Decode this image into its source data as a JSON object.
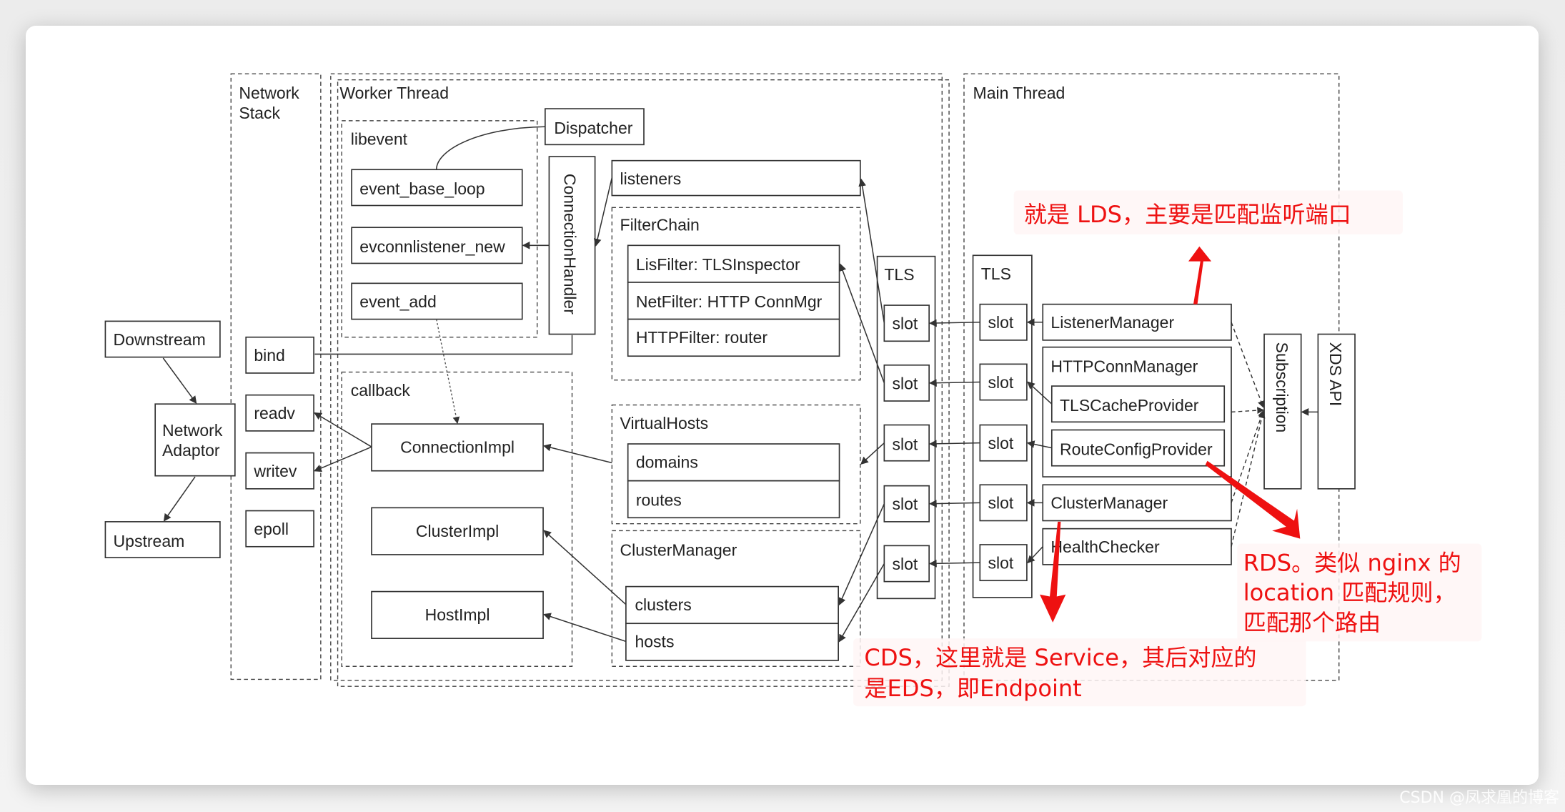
{
  "regions": {
    "network_stack": "Network\nStack",
    "worker_thread": "Worker Thread",
    "main_thread": "Main Thread",
    "libevent": "libevent",
    "callback": "callback",
    "filter_chain": "FilterChain",
    "virtual_hosts": "VirtualHosts",
    "cluster_manager_worker": "ClusterManager"
  },
  "external": {
    "downstream": "Downstream",
    "network_adaptor_1": "Network",
    "network_adaptor_2": "Adaptor",
    "upstream": "Upstream"
  },
  "network_stack_items": [
    "bind",
    "readv",
    "writev",
    "epoll"
  ],
  "network_stack_title": [
    "Network",
    "Stack"
  ],
  "libevent_items": [
    "event_base_loop",
    "evconnlistener_new",
    "event_add"
  ],
  "dispatcher": "Dispatcher",
  "connection_handler": "ConnectionHandler",
  "callback_items": [
    "ConnectionImpl",
    "ClusterImpl",
    "HostImpl"
  ],
  "listeners": "listeners",
  "filter_chain_items": [
    "LisFilter: TLSInspector",
    "NetFilter: HTTP ConnMgr",
    "HTTPFilter: router"
  ],
  "virtual_hosts_items": [
    "domains",
    "routes"
  ],
  "cluster_manager_items": [
    "clusters",
    "hosts"
  ],
  "tls_label": "TLS",
  "slot_label": "slot",
  "main_items": {
    "listener_manager": "ListenerManager",
    "http_conn_manager": "HTTPConnManager",
    "tls_cache_provider": "TLSCacheProvider",
    "route_config_provider": "RouteConfigProvider",
    "cluster_manager": "ClusterManager",
    "health_checker": "HealthChecker",
    "subscription": "Subscription",
    "xds_api": "XDS API"
  },
  "annotations": {
    "lds": "就是 LDS，主要是匹配监听端口",
    "rds_1": "RDS。类似 nginx 的",
    "rds_2": "location 匹配规则，",
    "rds_3": "匹配那个路由",
    "cds_1": "CDS，这里就是 Service，其后对应的",
    "cds_2": "是EDS，即Endpoint"
  },
  "colors": {
    "annotation": "#ee1111",
    "line": "#333333"
  },
  "watermark": "CSDN @凤求凰的博客"
}
